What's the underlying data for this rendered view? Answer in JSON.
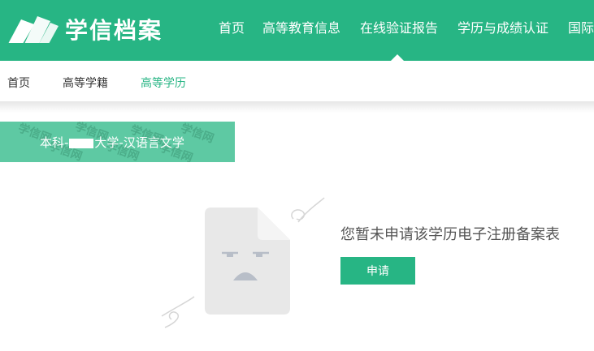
{
  "header": {
    "brand": "学信档案",
    "nav": [
      {
        "label": "首页"
      },
      {
        "label": "高等教育信息"
      },
      {
        "label": "在线验证报告"
      },
      {
        "label": "学历与成绩认证"
      },
      {
        "label": "国际"
      }
    ]
  },
  "subnav": {
    "items": [
      {
        "label": "首页"
      },
      {
        "label": "高等学籍"
      },
      {
        "label": "高等学历"
      }
    ]
  },
  "degree_tab": {
    "prefix": "本科-",
    "suffix": "大学-汉语言文学",
    "watermark": "学信网"
  },
  "empty_state": {
    "message": "您暂未申请该学历电子注册备案表",
    "button": "申请"
  },
  "colors": {
    "brand_green": "#27b584",
    "tab_green": "#5ec9a3"
  }
}
